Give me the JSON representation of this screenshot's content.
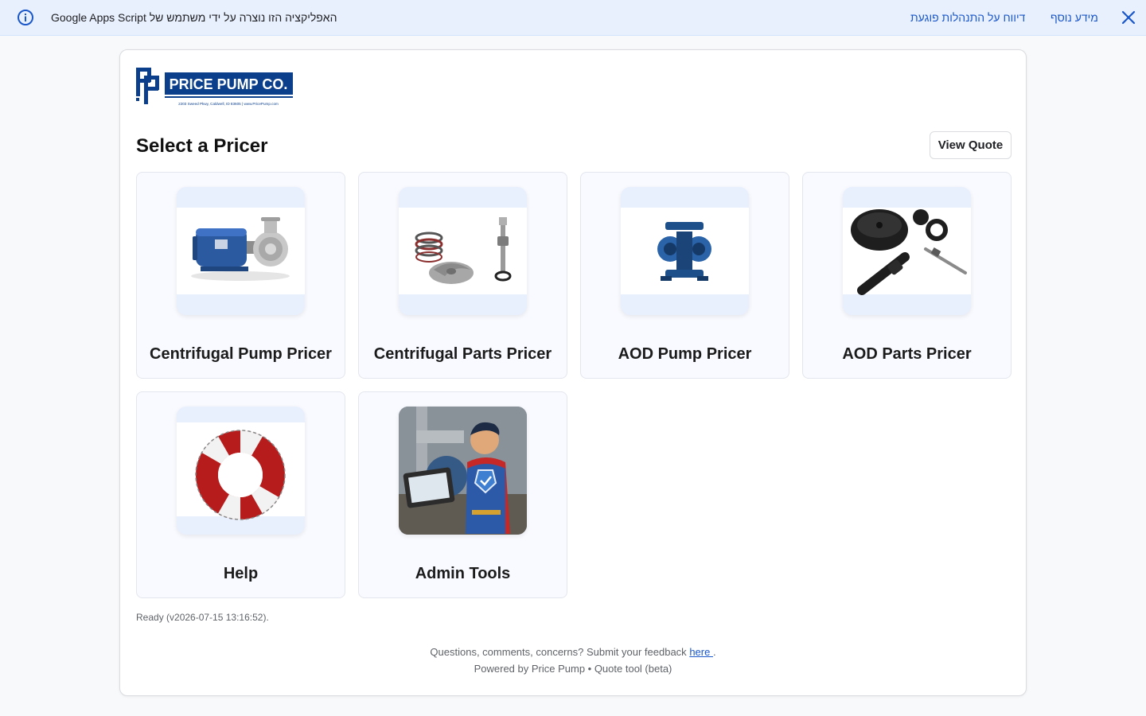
{
  "banner": {
    "message": "האפליקציה הזו נוצרה על ידי משתמש של Google Apps Script",
    "report_label": "דיווח על התנהלות פוגעת",
    "more_label": "מידע נוסף"
  },
  "logo": {
    "name": "PRICE PUMP CO.",
    "address": "2203 Sweed Pkwy, Caldwell, ID 83605 | www.PricePump.com"
  },
  "main": {
    "title": "Select a Pricer",
    "view_quote_label": "View Quote",
    "tiles": [
      {
        "label": "Centrifugal Pump Pricer",
        "icon": "centrifugal-pump-icon"
      },
      {
        "label": "Centrifugal Parts Pricer",
        "icon": "pump-parts-icon"
      },
      {
        "label": "AOD Pump Pricer",
        "icon": "aod-pump-icon"
      },
      {
        "label": "AOD Parts Pricer",
        "icon": "aod-parts-icon"
      },
      {
        "label": "Help",
        "icon": "life-ring-icon"
      },
      {
        "label": "Admin Tools",
        "icon": "admin-hero-icon"
      }
    ]
  },
  "status": "Ready (v2026-07-15 13:16:52).",
  "footer": {
    "feedback_prefix": "Questions, comments, concerns? Submit your feedback ",
    "feedback_link": "here ",
    "feedback_suffix": ".",
    "powered_by": "Powered by Price Pump • Quote tool (beta)"
  },
  "colors": {
    "brand_blue": "#0b3f8c",
    "banner_bg": "#e8f0fe",
    "link_blue": "#1a57c9"
  }
}
